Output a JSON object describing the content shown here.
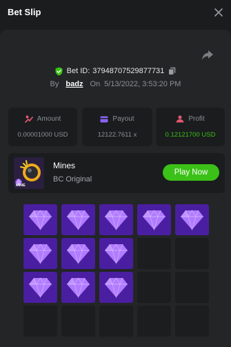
{
  "header": {
    "title": "Bet Slip"
  },
  "bet": {
    "id_label": "Bet ID:",
    "id": "37948707529877731",
    "by_label": "By",
    "user": "badz",
    "on_label": "On",
    "date": "5/13/2022, 3:53:20 PM"
  },
  "stats": {
    "amount": {
      "label": "Amount",
      "value": "0.00001000 USD"
    },
    "payout": {
      "label": "Payout",
      "value": "12122.7611 x"
    },
    "profit": {
      "label": "Profit",
      "value": "0.12121700 USD"
    }
  },
  "game": {
    "name": "Mines",
    "provider": "BC Original",
    "thumb_text": "MINE",
    "play_label": "Play Now"
  },
  "board": {
    "rows": [
      [
        "gem",
        "gem",
        "gem",
        "gem",
        "gem"
      ],
      [
        "gem",
        "gem",
        "gem",
        "empty",
        "empty"
      ],
      [
        "gem",
        "gem",
        "gem",
        "empty",
        "empty"
      ],
      [
        "empty",
        "empty",
        "empty",
        "empty",
        "empty"
      ]
    ]
  },
  "colors": {
    "accent_green": "#3bc117",
    "gem_tile": "#4a1ea0",
    "gem": "#b17bff",
    "amount_icon": "#e2566f",
    "payout_icon": "#8a63f5",
    "profit_icon": "#e2566f"
  },
  "icons": {
    "close": "close-icon",
    "share": "share-icon",
    "verified": "shield-check-icon",
    "copy": "copy-icon",
    "amount": "bet-coins-icon",
    "payout": "wallet-icon",
    "profit": "profit-icon",
    "gem": "diamond-icon"
  }
}
